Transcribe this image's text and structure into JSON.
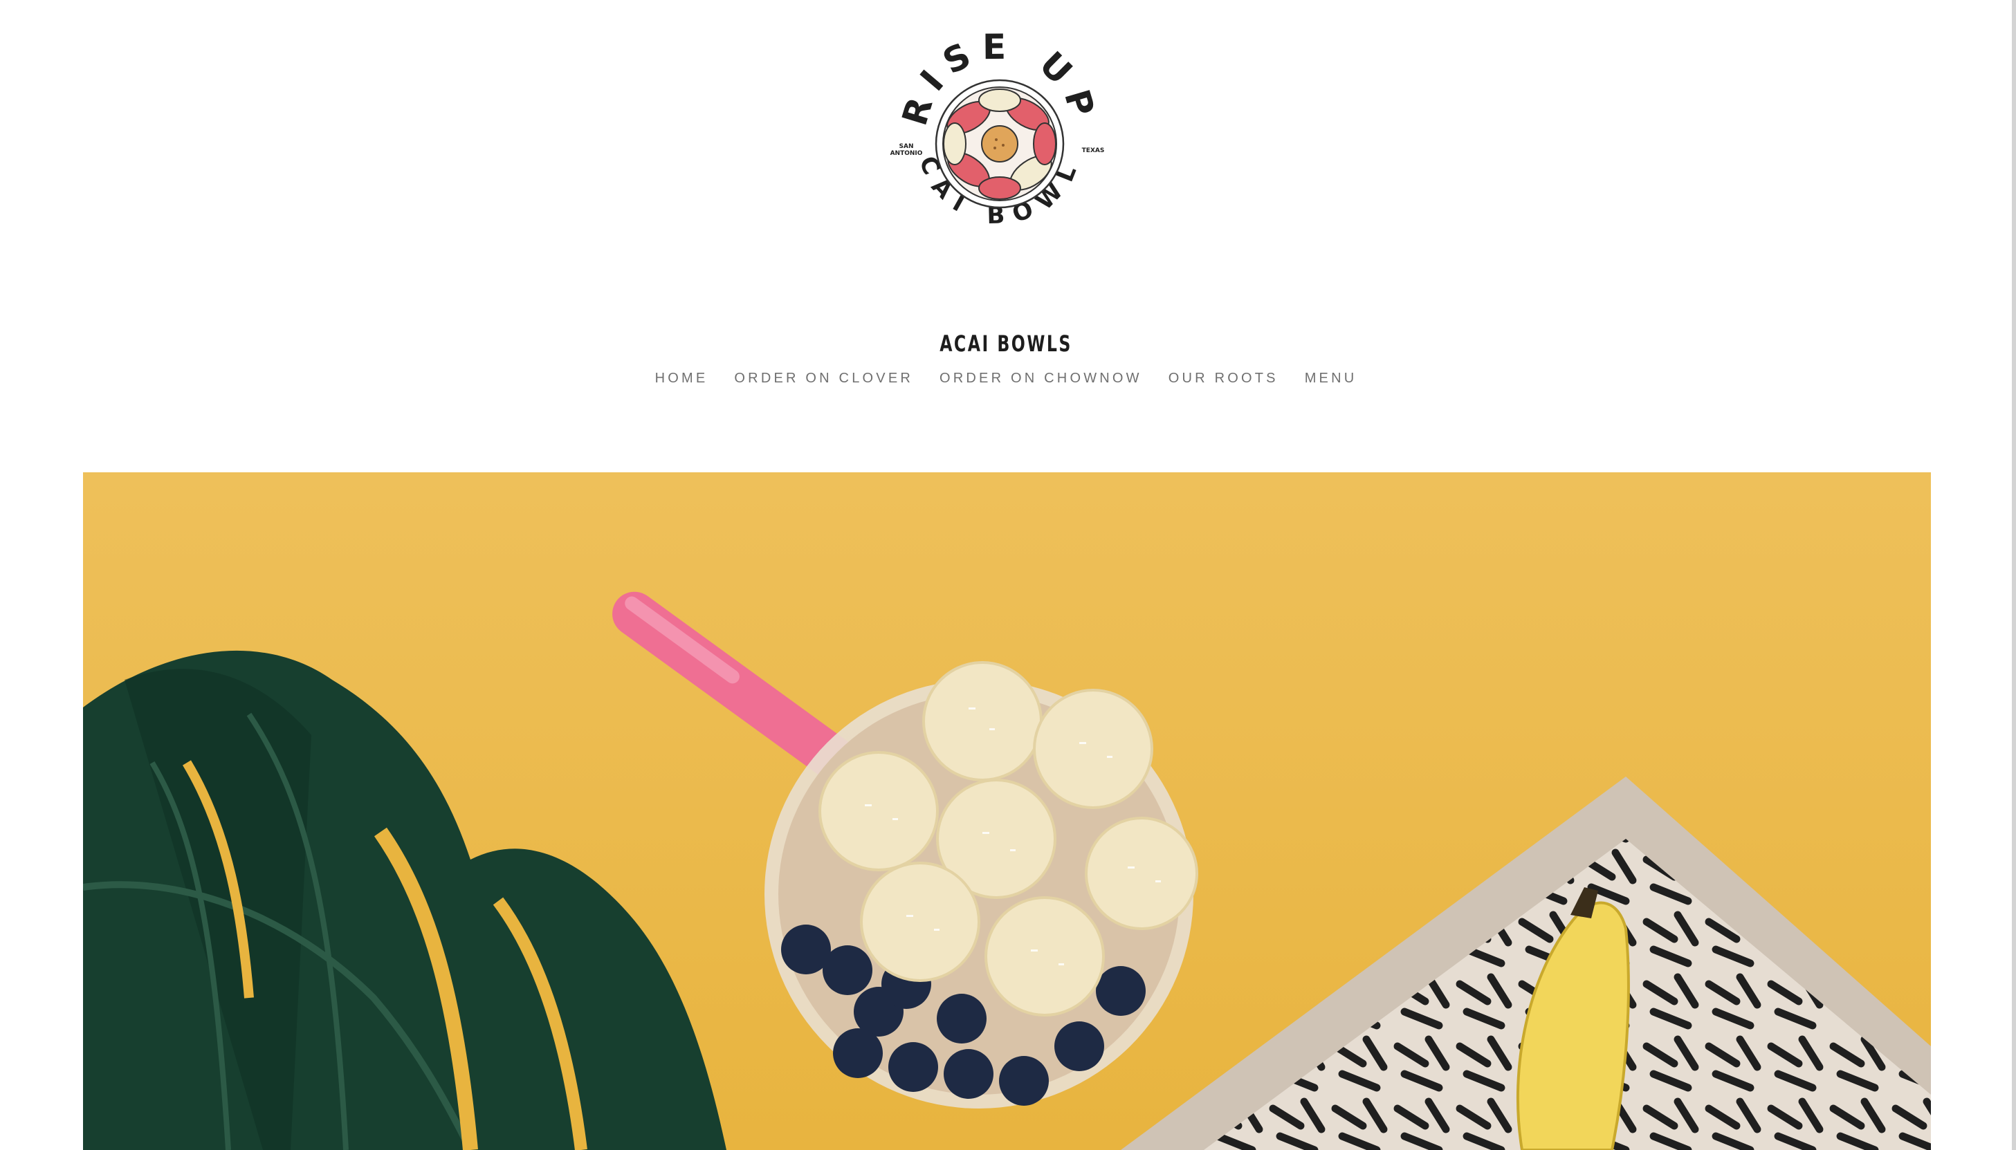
{
  "logo": {
    "top_text": "RISE UP",
    "bottom_text": "ACAI BOWLS",
    "left_text_1": "SAN",
    "left_text_2": "ANTONIO",
    "right_text": "TEXAS",
    "accent": "#e2606b"
  },
  "site": {
    "title": "ACAI BOWLS"
  },
  "nav": {
    "items": [
      {
        "label": "HOME"
      },
      {
        "label": "ORDER ON CLOVER"
      },
      {
        "label": "ORDER ON CHOWNOW"
      },
      {
        "label": "OUR ROOTS"
      },
      {
        "label": "MENU"
      }
    ]
  },
  "hero": {
    "background": "#edbc4f",
    "subjects": [
      "monstera-leaf",
      "acai-bowl",
      "pink-spoon",
      "wooden-tray",
      "banana"
    ]
  }
}
